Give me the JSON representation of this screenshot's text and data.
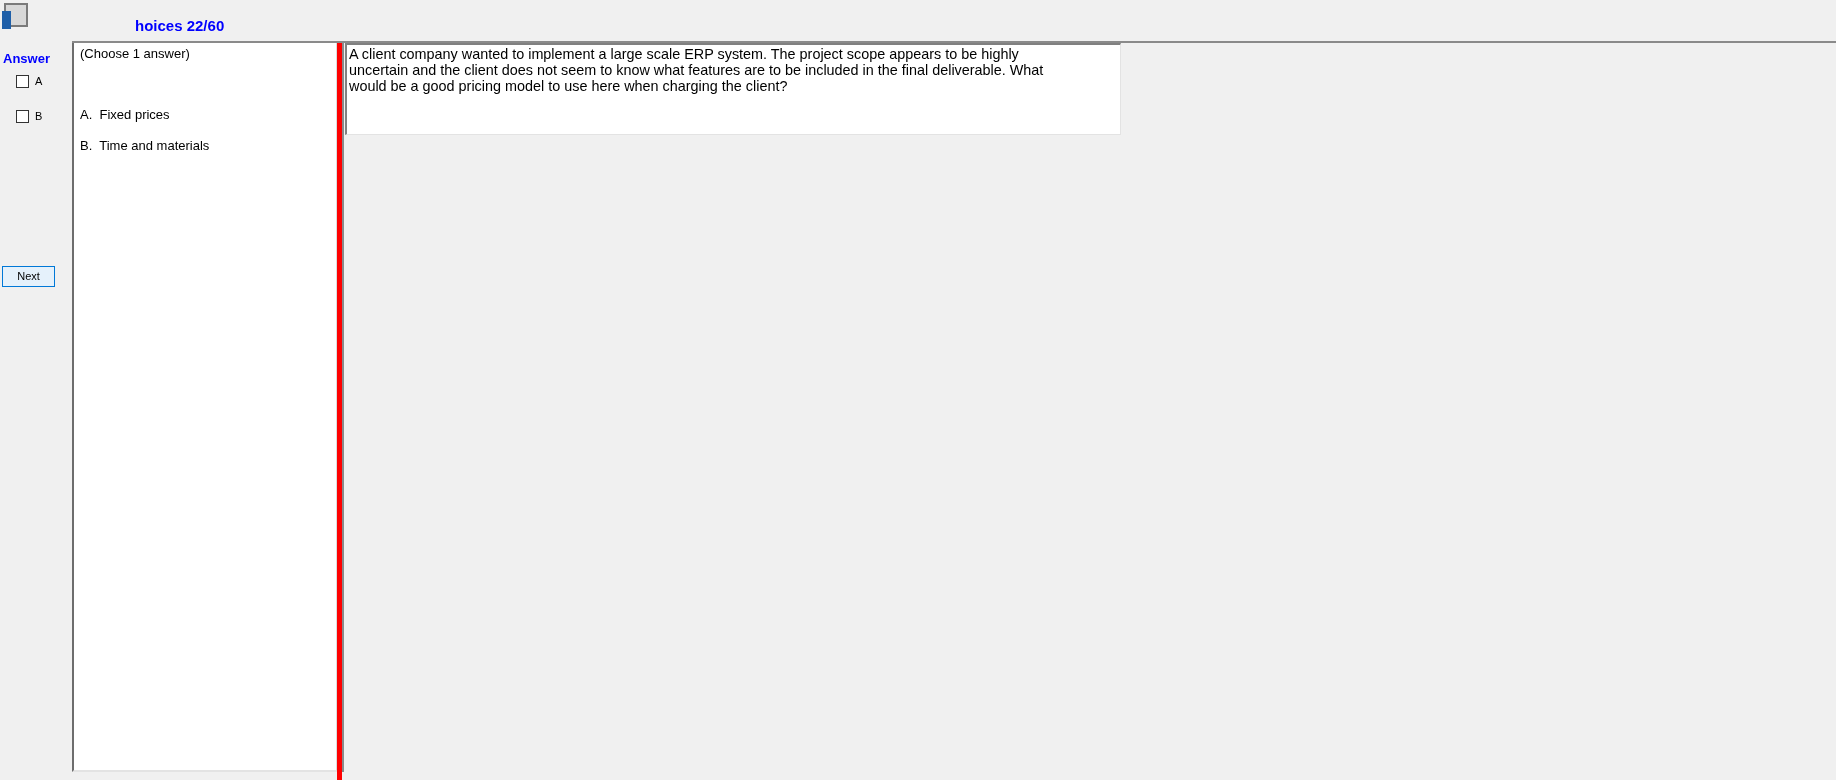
{
  "window": {
    "title": "hoices 22/60"
  },
  "answer_panel": {
    "heading": "Answer",
    "options": [
      {
        "label": "A",
        "checked": false
      },
      {
        "label": "B",
        "checked": false
      }
    ],
    "next_button": "Next"
  },
  "choices_panel": {
    "instruction": "(Choose 1 answer)",
    "choices": [
      "A.  Fixed prices",
      "B.  Time and materials"
    ]
  },
  "question": {
    "text": "A client company wanted to implement a large scale ERP system. The project scope appears to be highly uncertain and the client does not seem to know what features are to be included in the final deliverable. What would be a good pricing model to use here when charging the client?"
  }
}
